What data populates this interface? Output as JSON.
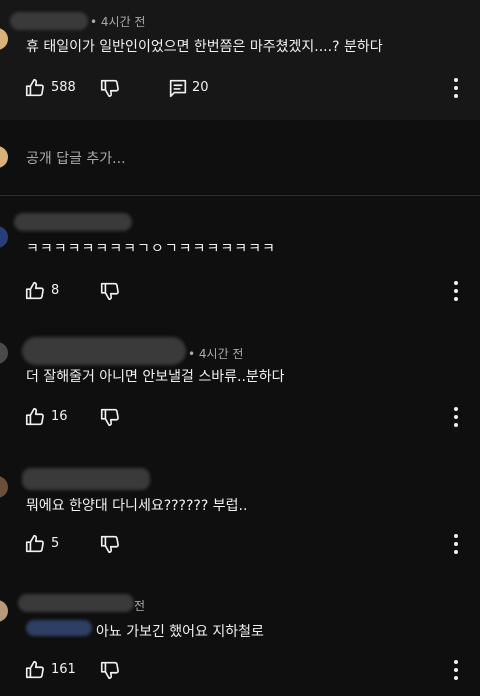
{
  "top_comment": {
    "time": "4시간 전",
    "text": "휴 태일이가 일반인이었으면 한번쯤은 마주쳤겠지....? 분하다",
    "likes": "588",
    "replies": "20"
  },
  "reply_input": {
    "placeholder": "공개 답글 추가..."
  },
  "replies": [
    {
      "time": "",
      "text": "ㅋㅋㅋㅋㅋㅋㅋㅋㄱㅇㄱㅋㅋㅋㅋㅋㅋㅋ",
      "likes": "8"
    },
    {
      "time": "4시간 전",
      "text": "더 잘해줄거 아니면 안보낼걸 스바류..분하다",
      "likes": "16"
    },
    {
      "time": "",
      "text": "뭐에요 한양대 다니세요?????? 부럽..",
      "likes": "5"
    },
    {
      "time": "전",
      "text": "아뇨 가보긴 했어요 지하철로",
      "likes": "161"
    }
  ],
  "colors": {
    "background": "#0f0f0f",
    "highlight": "#171717",
    "text": "#f1f1f1",
    "secondary": "#aaaaaa"
  }
}
